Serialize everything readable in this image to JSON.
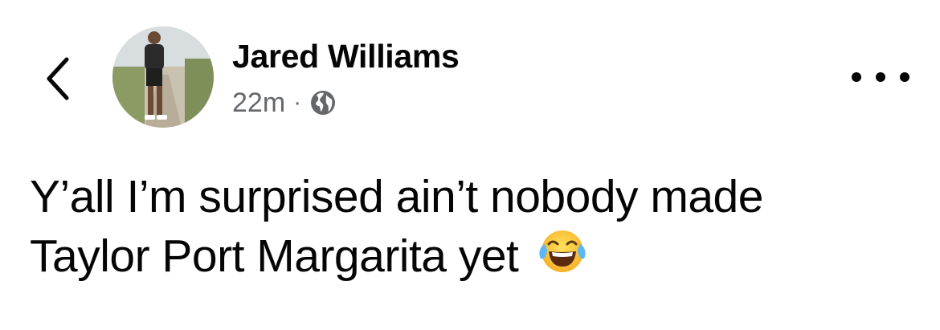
{
  "post": {
    "author_name": "Jared Williams",
    "timestamp": "22m",
    "separator": "·",
    "privacy_icon": "globe-icon",
    "text_line_1": "Y’all I’m surprised ain’t nobody made",
    "text_line_2": "Taylor Port Margarita yet",
    "emoji": "face-with-tears-of-joy-icon"
  },
  "nav": {
    "back_icon": "chevron-left-icon",
    "more_icon": "more-options-icon"
  }
}
